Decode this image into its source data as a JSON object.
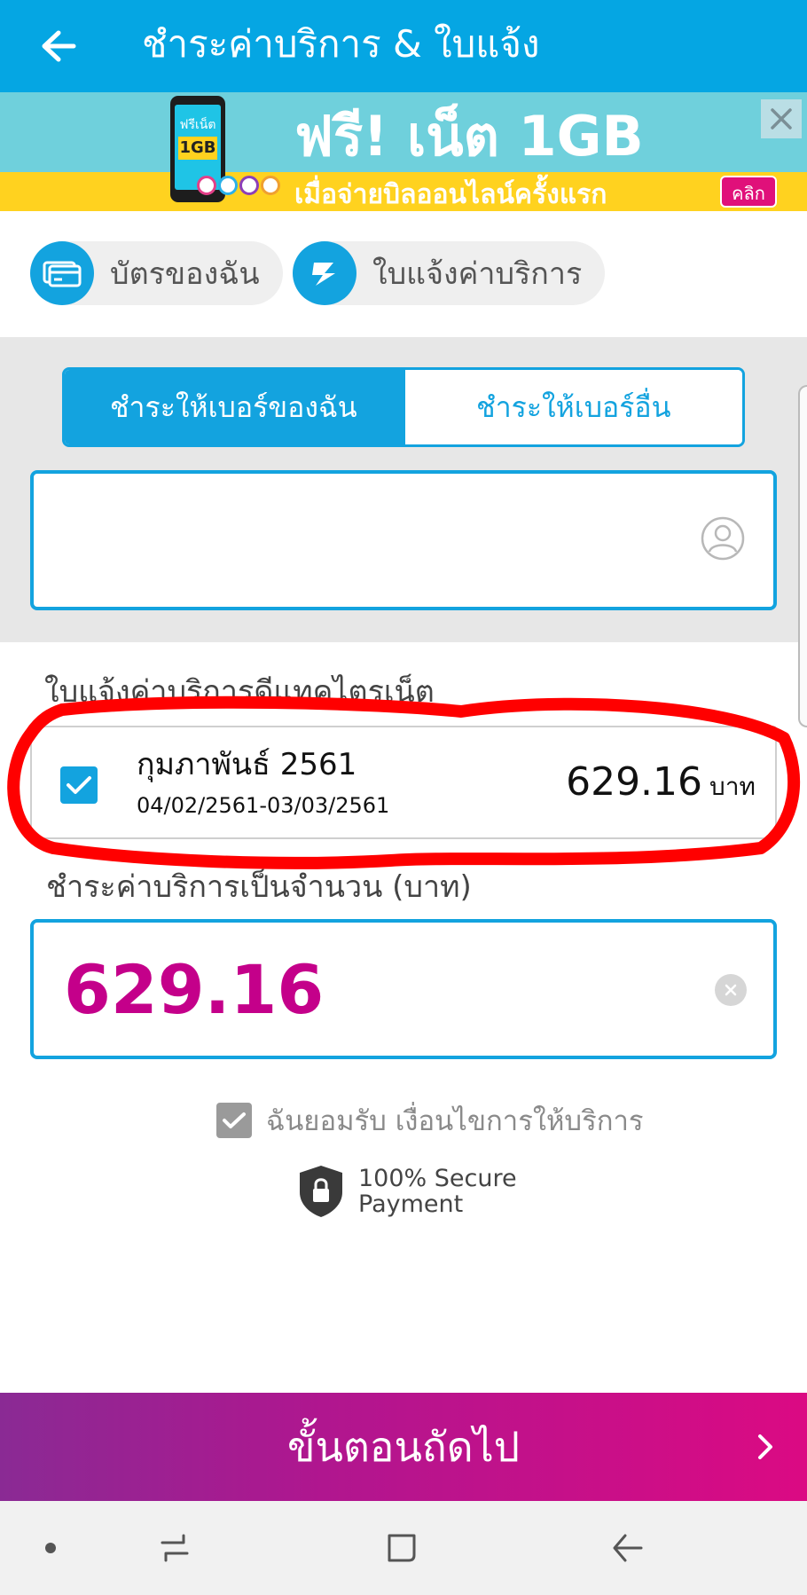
{
  "header": {
    "title": "ชำระค่าบริการ & ใบแจ้ง",
    "back_icon": "arrow-left-icon",
    "color": "#05a6e3"
  },
  "banner": {
    "phone_label": "ฟรีเน็ต",
    "phone_gb": "1GB",
    "headline": "ฟรี! เน็ต 1GB",
    "subline": "เมื่อจ่ายบิลออนไลน์ครั้งแรก",
    "cta": "คลิก",
    "close_icon": "close-icon"
  },
  "shortcuts": [
    {
      "label": "บัตรของฉัน",
      "icon": "credit-card-icon"
    },
    {
      "label": "ใบแจ้งค่าบริการ",
      "icon": "bill-icon"
    }
  ],
  "pay_target": {
    "options": [
      "ชำระให้เบอร์ของฉัน",
      "ชำระให้เบอร์อื่น"
    ],
    "selected": "ชำระให้เบอร์ของฉัน"
  },
  "phone_input": {
    "value": "",
    "icon": "contact-icon"
  },
  "bill_section": {
    "title": "ใบแจ้งค่าบริการดีแทคไตรเน็ต",
    "bills": [
      {
        "checked": true,
        "month": "กุมภาพันธ์ 2561",
        "period": "04/02/2561-03/03/2561",
        "amount": "629.16",
        "unit": "บาท"
      }
    ],
    "annotation_color": "#ff0000"
  },
  "amount_section": {
    "title": "ชำระค่าบริการเป็นจำนวน (บาท)",
    "value": "629.16",
    "value_color": "#c4008a"
  },
  "terms": {
    "checked": true,
    "label": "ฉันยอมรับ เงื่อนไขการให้บริการ"
  },
  "secure": {
    "line1": "100% Secure",
    "line2": "Payment",
    "icon": "lock-shield-icon"
  },
  "next_button": {
    "label": "ขั้นตอนถัดไป",
    "icon": "chevron-right-icon"
  },
  "system_nav": {
    "items": [
      "dot-icon",
      "recent-apps-icon",
      "home-icon",
      "back-icon"
    ]
  }
}
